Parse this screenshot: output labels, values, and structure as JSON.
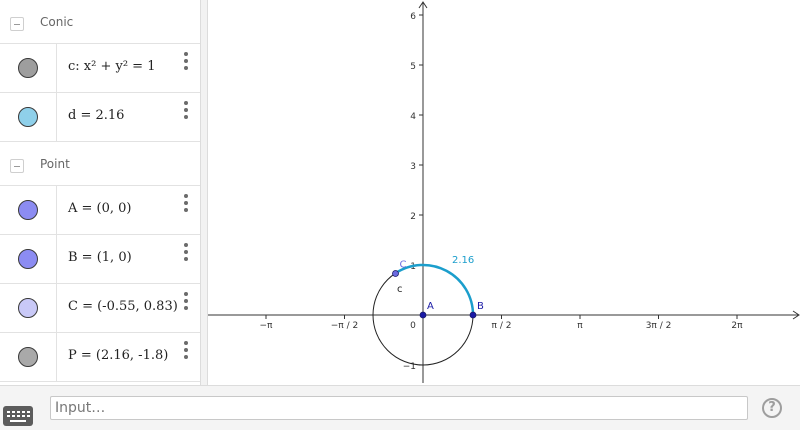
{
  "algebra": {
    "groups": [
      {
        "label": "Conic",
        "items": [
          {
            "text": "c: x² + y² = 1",
            "color": "#9e9e9e"
          },
          {
            "text": "d = 2.16",
            "color": "#8fd0ea"
          }
        ]
      },
      {
        "label": "Point",
        "items": [
          {
            "text": "A = (0, 0)",
            "color": "#8c8cf2"
          },
          {
            "text": "B = (1, 0)",
            "color": "#8c8cf2"
          },
          {
            "text": "C = (-0.55, 0.83)",
            "color": "#c9c9f7"
          },
          {
            "text": "P = (2.16, -1.8)",
            "color": "#a9a9a9"
          }
        ]
      }
    ]
  },
  "graphics": {
    "x_tick_labels": [
      "−π",
      "−π / 2",
      "0",
      "π / 2",
      "π",
      "3π / 2",
      "2π"
    ],
    "y_tick_labels": [
      "−1",
      "2",
      "3",
      "4",
      "5",
      "6"
    ],
    "points": [
      {
        "name": "A",
        "label": "A",
        "x": 0,
        "y": 0,
        "color": "#1a1aa6"
      },
      {
        "name": "B",
        "label": "B",
        "x": 1,
        "y": 0,
        "color": "#1a1aa6"
      },
      {
        "name": "C",
        "label": "C",
        "x": -0.55,
        "y": 0.83,
        "color": "#6b6be0"
      }
    ],
    "circle_label": "c",
    "arc_label": "2.16",
    "arc_color": "#1b9ecc",
    "y_one_label": "1"
  },
  "input": {
    "placeholder": "Input…"
  },
  "help_label": "?"
}
